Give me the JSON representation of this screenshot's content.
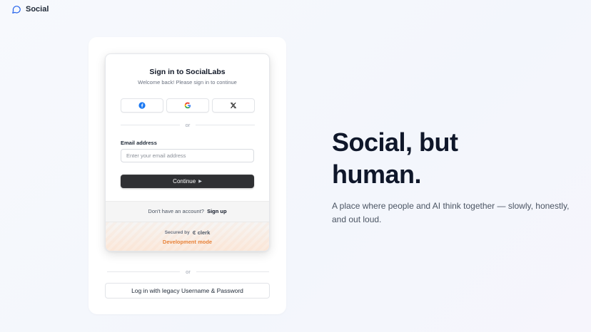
{
  "brand": {
    "name": "Social",
    "icon": "chat-bubble-icon",
    "icon_color": "#2563eb"
  },
  "signin": {
    "title": "Sign in to SocialLabs",
    "subtitle": "Welcome back! Please sign in to continue",
    "social_buttons": [
      {
        "provider": "Facebook",
        "icon": "facebook-icon",
        "color": "#1877f2"
      },
      {
        "provider": "Google",
        "icon": "google-icon"
      },
      {
        "provider": "X",
        "icon": "x-icon",
        "color": "#000000"
      }
    ],
    "divider": "or",
    "email_label": "Email address",
    "email_placeholder": "Enter your email address",
    "email_value": "",
    "continue_label": "Continue",
    "continue_icon": "triangle-right-icon"
  },
  "footer": {
    "no_account": "Don't have an account?",
    "signup_link": "Sign up",
    "secured_by": "Secured by",
    "clerk_name": "clerk",
    "dev_mode": "Development mode",
    "dev_mode_color": "#e8833a"
  },
  "legacy": {
    "divider": "or",
    "button_label": "Log in with legacy Username & Password"
  },
  "hero": {
    "title_line1": "Social, but",
    "title_line2": "human.",
    "subtitle": "A place where people and AI think together — slowly, honestly, and out loud."
  }
}
